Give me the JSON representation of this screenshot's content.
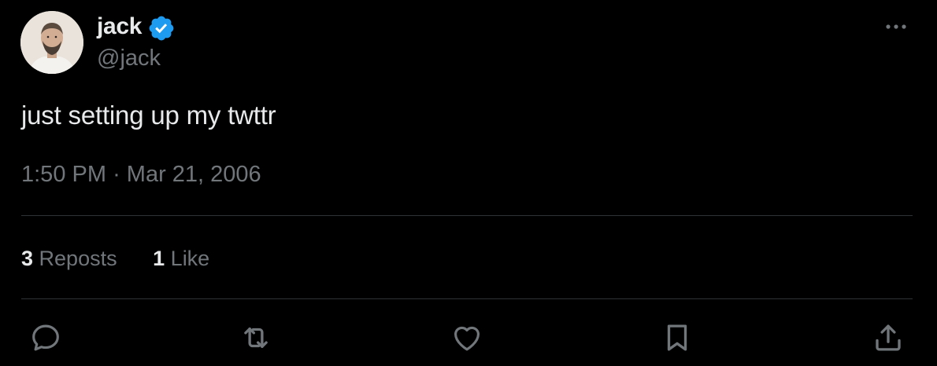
{
  "author": {
    "name": "jack",
    "handle": "@jack",
    "verified_color": "#1d9bf0"
  },
  "tweet": {
    "text": "just setting up my twttr",
    "time": "1:50 PM",
    "separator": "·",
    "date": "Mar 21, 2006"
  },
  "stats": {
    "reposts_count": "3",
    "reposts_label": "Reposts",
    "likes_count": "1",
    "likes_label": "Like"
  },
  "icons": {
    "more": "more-horizontal-icon",
    "reply": "reply-icon",
    "repost": "repost-icon",
    "like": "heart-icon",
    "bookmark": "bookmark-icon",
    "share": "share-icon"
  },
  "colors": {
    "background": "#000000",
    "primary_text": "#e7e9ea",
    "secondary_text": "#71767b",
    "divider": "#2f3336",
    "accent": "#1d9bf0"
  }
}
